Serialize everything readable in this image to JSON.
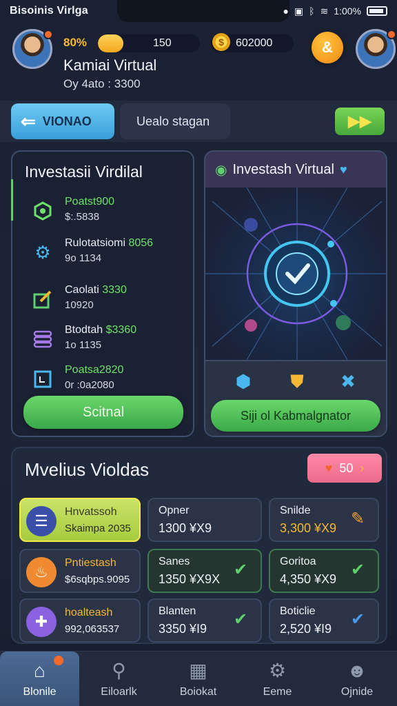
{
  "status_bar": {
    "app_name": "Bisoinis Virlga",
    "right_text": "1:00%"
  },
  "header": {
    "xp_percent_text": "80%",
    "xp_fill_fraction": 0.25,
    "xp_value": "150",
    "coins_value": "602000",
    "player_name": "Kamiai Virtual",
    "player_sub": "Oy 4ato : 3300"
  },
  "nav": {
    "back_label": "VIONAO",
    "middle_tab_label": "Uealo stagan",
    "forward_label": "▶▶"
  },
  "left_panel": {
    "title": "Investasii Virdilal",
    "items": [
      {
        "name_prefix": "",
        "name_highlight": "Poatst900",
        "value": "$:.5838",
        "icon": "hexagon-icon",
        "color": "#6fe06c"
      },
      {
        "name_prefix": "Rulotatsiomi ",
        "name_highlight": "8056",
        "value": "9o 1134",
        "icon": "gear-icon",
        "color": "#4ab8ee"
      },
      {
        "name_prefix": "Caolati ",
        "name_highlight": "3330",
        "value": "10920",
        "icon": "edit-icon",
        "color": "#5fd06d"
      },
      {
        "name_prefix": "Btodtah ",
        "name_highlight": "$3360",
        "value": "1o 1135",
        "icon": "coins-stack-icon",
        "color": "#a479e8"
      },
      {
        "name_prefix": "",
        "name_highlight": "Poatsa2820",
        "value": "0r :0a2080",
        "icon": "document-icon",
        "color": "#4ab8ee"
      }
    ],
    "button_label": "Scitnal"
  },
  "right_panel": {
    "title": "Investash Virtual",
    "button_label": "Siji ol Kabmalgnator"
  },
  "bottom_panel": {
    "title": "Mvelius Violdas",
    "badge_value": "50",
    "cards": [
      {
        "name": "Hnvatssoh",
        "value": "Skaimpa 2035",
        "style": "highlight",
        "icon": "list-icon",
        "icon_color": "#3a66c8"
      },
      {
        "name": "Opner",
        "value": "1300 ¥X9",
        "style": "plain",
        "icon": "",
        "icon_color": ""
      },
      {
        "name": "Snilde",
        "value": "3,300 ¥X9",
        "style": "plain",
        "icon": "check-badge-icon",
        "icon_color": "#f0a030"
      },
      {
        "name": "Pntiestash",
        "value": "$6sqbps.9095",
        "style": "plain",
        "icon": "cake-icon",
        "icon_color": "#f08a30"
      },
      {
        "name": "Sanes",
        "value": "1350 ¥X9X",
        "style": "green",
        "icon": "check-icon",
        "icon_color": "#5fd06d"
      },
      {
        "name": "Goritoa",
        "value": "4,350 ¥X9",
        "style": "green",
        "icon": "check-icon",
        "icon_color": "#5fd06d"
      },
      {
        "name": "hoalteash",
        "value": "992,063537",
        "style": "plain",
        "icon": "puzzle-icon",
        "icon_color": "#8a62e0"
      },
      {
        "name": "Blanten",
        "value": "3350 ¥I9",
        "style": "plain",
        "icon": "check-icon",
        "icon_color": "#5fd06d"
      },
      {
        "name": "Boticlie",
        "value": "2,520 ¥I9",
        "style": "plain",
        "icon": "check-icon",
        "icon_color": "#4a9ce8"
      }
    ]
  },
  "tab_bar": {
    "tabs": [
      {
        "label": "Blonile",
        "icon": "home-icon",
        "active": true
      },
      {
        "label": "Eiloarlk",
        "icon": "search-icon",
        "active": false
      },
      {
        "label": "Boiokat",
        "icon": "box-icon",
        "active": false
      },
      {
        "label": "Eeme",
        "icon": "gear-icon",
        "active": false
      },
      {
        "label": "Ojnide",
        "icon": "user-icon",
        "active": false
      }
    ]
  },
  "colors": {
    "accent_green": "#46a83a",
    "accent_blue": "#3a9fd9",
    "gold": "#f6b834",
    "badge_pink": "#ec6a8b"
  }
}
